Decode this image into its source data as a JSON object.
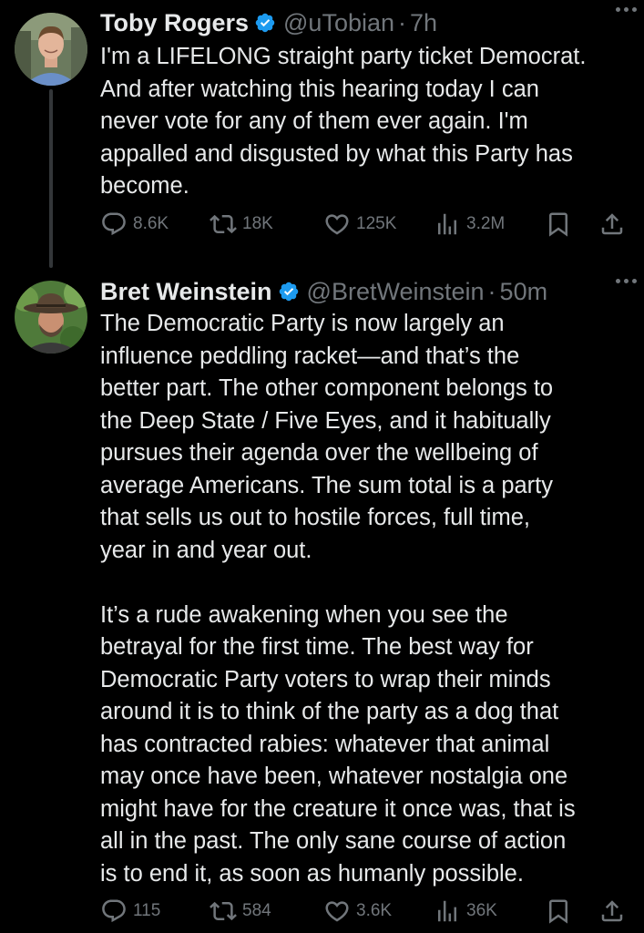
{
  "tweets": [
    {
      "display_name": "Toby Rogers",
      "handle": "@uTobian",
      "separator": "·",
      "time": "7h",
      "text": "I'm a LIFELONG straight party ticket Democrat.\nAnd after watching this hearing today I can\nnever vote for any of them ever again. I'm\nappalled and disgusted by what this Party has\nbecome.",
      "replies": "8.6K",
      "reposts": "18K",
      "likes": "125K",
      "views": "3.2M"
    },
    {
      "display_name": "Bret Weinstein",
      "handle": "@BretWeinstein",
      "separator": "·",
      "time": "50m",
      "text": "The Democratic Party is now largely an\ninfluence peddling racket—and that’s the\nbetter part. The other component belongs to\nthe Deep State / Five Eyes, and it habitually\npursues their agenda over the wellbeing of\naverage Americans. The sum total is a party\nthat sells us out to hostile forces, full time,\nyear in and year out.\n\nIt’s a rude awakening when you see the\nbetrayal for the first time. The best way for\nDemocratic Party voters to wrap their minds\naround it is to think of the party as a dog that\nhas contracted rabies: whatever that animal\nmay once have been, whatever nostalgia one\nmight have for the creature it once was, that is\nall in the past. The only sane course of action\nis to end it, as soon as humanly possible.",
      "replies": "115",
      "reposts": "584",
      "likes": "3.6K",
      "views": "36K"
    }
  ],
  "colors": {
    "background": "#000000",
    "text": "#e7e9ea",
    "secondary": "#71767b",
    "verified": "#1d9bf0",
    "thread_line": "#333639"
  },
  "icons": {
    "verified": "verified-badge-icon",
    "reply": "reply-icon",
    "repost": "repost-icon",
    "like": "heart-icon",
    "views": "views-icon",
    "bookmark": "bookmark-icon",
    "share": "share-icon",
    "more": "more-icon"
  }
}
